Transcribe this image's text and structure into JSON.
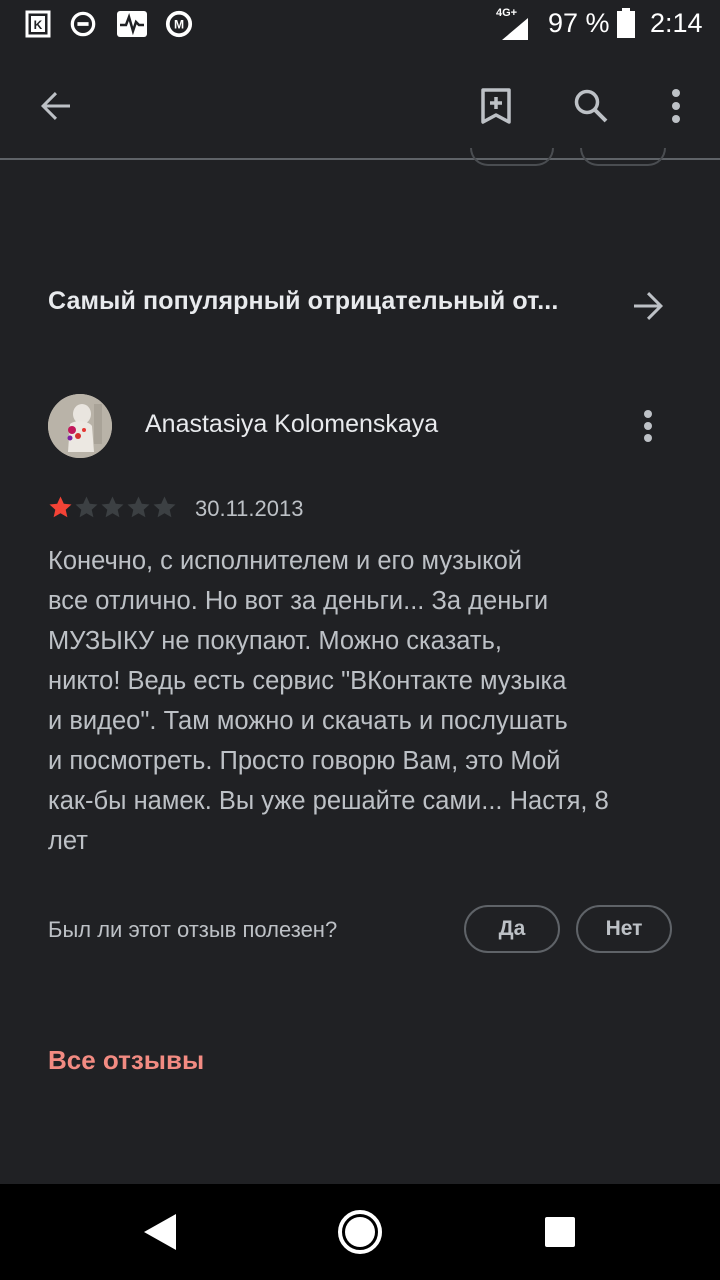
{
  "status_bar": {
    "network": "4G+",
    "battery": "97 %",
    "time": "2:14",
    "icons": [
      "k-app-icon",
      "do-not-disturb-icon",
      "pulse-app-icon",
      "m-app-icon",
      "signal-icon",
      "battery-icon"
    ]
  },
  "app_bar": {
    "icons": [
      "back-arrow-icon",
      "bookmark-add-icon",
      "search-icon",
      "more-vert-icon"
    ]
  },
  "section": {
    "title": "Самый популярный отрицательный от...",
    "arrow_icon": "arrow-forward-icon"
  },
  "review": {
    "author": "Anastasiya Kolomenskaya",
    "rating": 1,
    "max_rating": 5,
    "date": "30.11.2013",
    "text_lines": [
      "Конечно, с исполнителем и его музыкой",
      "все отлично. Но вот за деньги... За деньги",
      "МУЗЫКУ не покупают. Можно сказать,",
      "никто! Ведь есть сервис \"ВКонтакте музыка",
      "и видео\". Там можно и скачать и послушать",
      "и посмотреть. Просто говорю Вам, это Мой",
      "как-бы намек. Вы уже решайте сами... Настя, 8",
      "лет"
    ],
    "helpful_question": "Был ли этот отзыв полезен?",
    "yes_label": "Да",
    "no_label": "Нет"
  },
  "all_reviews_label": "Все отзывы",
  "nav_bar": {
    "icons": [
      "nav-back-icon",
      "nav-home-icon",
      "nav-recents-icon"
    ]
  },
  "colors": {
    "background": "#202124",
    "star_filled": "#f44336",
    "star_empty": "#3c4043",
    "accent_link": "#f28b82",
    "text_primary": "#e8eaed",
    "text_secondary": "#bdc1c6"
  }
}
